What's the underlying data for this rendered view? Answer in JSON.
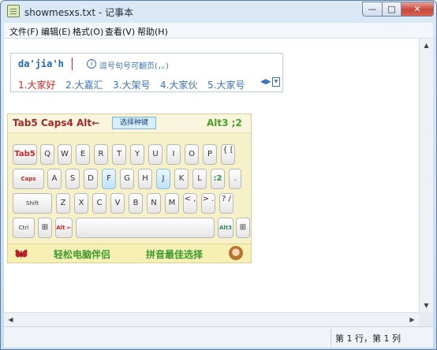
{
  "window": {
    "title": "showmesxs.txt - 记事本",
    "min_icon": "—",
    "max_icon": "□",
    "close_icon": "✕"
  },
  "menu": [
    "文件(F)",
    "编辑(E)",
    "格式(O)",
    "查看(V)",
    "帮助(H)"
  ],
  "ime": {
    "pinyin": "da'jia'h",
    "hint_icon": "i",
    "hint": "逗号句号可翻页(，。)",
    "candidates": [
      "1.大家好",
      "2.大嘉汇",
      "3.大架号",
      "4.大家伙",
      "5.大家号"
    ],
    "nav": "◀▶",
    "dropdown": "▼"
  },
  "keyboard": {
    "left_label": "Tab5   Caps4   Alt←",
    "select_label": "选择种键",
    "right_label": "Alt3   ;2",
    "bottom_left": "轻松电脑伴侣",
    "bottom_right": "拼音最佳选择",
    "rows": [
      [
        "Tab5",
        "Q",
        "W",
        "E",
        "R",
        "T",
        "Y",
        "U",
        "I",
        "O",
        "P",
        "{ ["
      ],
      [
        "Caps Lock 4",
        "A",
        "S",
        "D",
        "F",
        "G",
        "H",
        "J",
        "K",
        "L",
        ":2",
        "."
      ],
      [
        "Shift",
        "Z",
        "X",
        "C",
        "V",
        "B",
        "N",
        "M",
        "< ,",
        "> .",
        "? /"
      ],
      [
        "Ctrl",
        "⊞",
        "Alt ←",
        "",
        "Alt3",
        "⊞"
      ]
    ]
  },
  "status": {
    "position": "第 1 行，第 1 列"
  },
  "colors": {
    "accent": "#3a74b8",
    "highlight": "#d22",
    "keyboard_bg": "#f6f1c9",
    "green_text": "#3d9a2f"
  }
}
